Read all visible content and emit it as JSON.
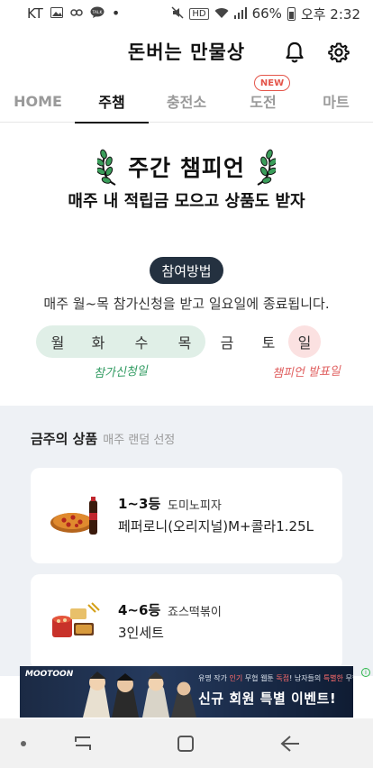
{
  "status_bar": {
    "carrier": "KT",
    "battery": "66%",
    "time": "오후 2:32",
    "talk_badge": "TALK",
    "hd_label": "HD"
  },
  "header": {
    "title": "돈버는 만물상"
  },
  "tabs": [
    {
      "label": "HOME",
      "active": false
    },
    {
      "label": "주챔",
      "active": true
    },
    {
      "label": "충전소",
      "active": false
    },
    {
      "label": "도전",
      "active": false
    },
    {
      "label": "마트",
      "active": false
    }
  ],
  "new_badge": "NEW",
  "hero": {
    "title": "주간 챔피언",
    "subtitle": "매주 내 적립금 모으고 상품도 받자",
    "howto_label": "참여방법",
    "howto_desc": "매주 월~목 참가신청을 받고 일요일에 종료됩니다.",
    "days": [
      "월",
      "화",
      "수",
      "목",
      "금",
      "토",
      "일"
    ],
    "signup_note": "참가신청일",
    "announce_note": "챔피언 발표일",
    "colors": {
      "signup_range": "#e0efe7",
      "announce_day": "#fbe1e1",
      "pill": "#243140"
    }
  },
  "products": {
    "title": "금주의 상품",
    "note": "매주 랜덤 선정",
    "items": [
      {
        "rank": "1~3등",
        "brand": "도미노피자",
        "desc": "페퍼로니(오리지널)M+콜라1.25L",
        "icon": "pizza-cola-image"
      },
      {
        "rank": "4~6등",
        "brand": "죠스떡볶이",
        "desc": "3인세트",
        "icon": "tteokbokki-set-image"
      }
    ]
  },
  "ad": {
    "logo": "MOOTOON",
    "top_prefix": "유명 작가 ",
    "top_hl1": "인기",
    "top_mid1": " 무협 웹툰 ",
    "top_hl2": "독점",
    "top_mid2": "! 남자들의 ",
    "top_hl3": "특별한",
    "top_suffix": " 무협 공간",
    "main": "신규 회원 특별 이벤트!",
    "info": "i"
  }
}
